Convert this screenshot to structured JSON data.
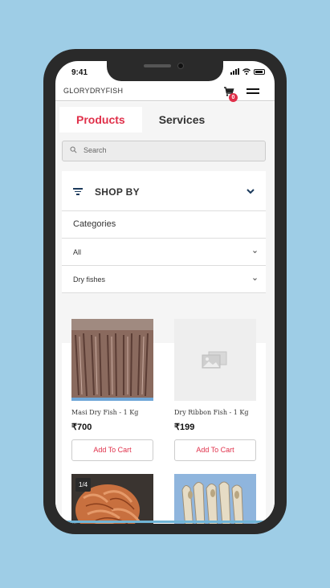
{
  "status": {
    "time": "9:41"
  },
  "header": {
    "brand": "GLORYDRYFISH",
    "cart_count": "0"
  },
  "tabs": [
    {
      "label": "Products",
      "active": true
    },
    {
      "label": "Services",
      "active": false
    }
  ],
  "search": {
    "placeholder": "Search"
  },
  "filters": {
    "shop_by_label": "SHOP BY",
    "categories_label": "Categories",
    "selects": [
      {
        "value": "All"
      },
      {
        "value": "Dry fishes"
      }
    ]
  },
  "products": [
    {
      "name": "Masi Dry Fish - 1 Kg",
      "price": "₹700",
      "button": "Add To Cart"
    },
    {
      "name": "Dry Ribbon Fish - 1 Kg",
      "price": "₹199",
      "button": "Add To Cart"
    }
  ],
  "image_counter": "1/4",
  "colors": {
    "accent": "#e0304a",
    "navy": "#1b3a5c",
    "background": "#9ecde6"
  }
}
